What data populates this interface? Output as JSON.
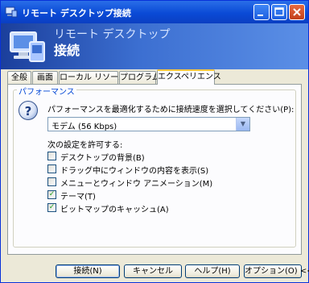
{
  "window": {
    "title": "リモート デスクトップ接続"
  },
  "banner": {
    "line1": "リモート デスクトップ",
    "line2": "接続"
  },
  "tabs": [
    {
      "label": "全般"
    },
    {
      "label": "画面"
    },
    {
      "label": "ローカル リソース"
    },
    {
      "label": "プログラム"
    },
    {
      "label": "エクスペリエンス",
      "active": true
    }
  ],
  "performance": {
    "group_title": "パフォーマンス",
    "description": "パフォーマンスを最適化するために接続速度を選択してください(P):",
    "speed_selected": "モデム (56 Kbps)",
    "allow_label": "次の設定を許可する:",
    "options": [
      {
        "label": "デスクトップの背景(B)",
        "checked": false
      },
      {
        "label": "ドラッグ中にウィンドウの内容を表示(S)",
        "checked": false
      },
      {
        "label": "メニューとウィンドウ アニメーション(M)",
        "checked": false
      },
      {
        "label": "テーマ(T)",
        "checked": true
      },
      {
        "label": "ビットマップのキャッシュ(A)",
        "checked": true
      }
    ]
  },
  "buttons": {
    "connect": "接続(N)",
    "cancel": "キャンセル",
    "help": "ヘルプ(H)",
    "options": "オプション(O) <<"
  },
  "colors": {
    "titlebar": "#0a4ad6",
    "group_title": "#0046d5",
    "active_tab_highlight": "#ffc83c"
  }
}
